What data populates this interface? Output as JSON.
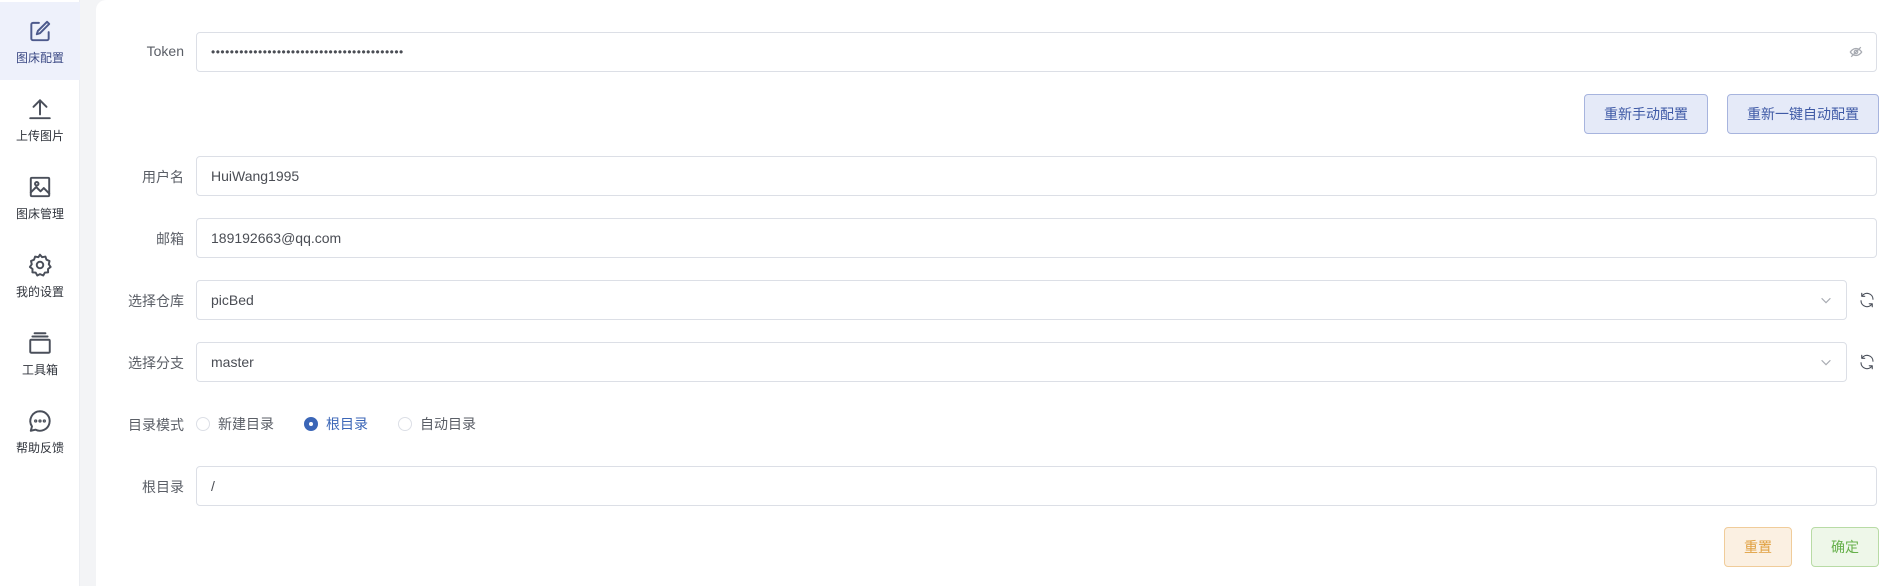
{
  "sidebar": {
    "items": [
      {
        "label": "图床配置",
        "icon": "edit-icon",
        "active": true
      },
      {
        "label": "上传图片",
        "icon": "upload-icon",
        "active": false
      },
      {
        "label": "图床管理",
        "icon": "image-icon",
        "active": false
      },
      {
        "label": "我的设置",
        "icon": "gear-icon",
        "active": false
      },
      {
        "label": "工具箱",
        "icon": "toolbox-icon",
        "active": false
      },
      {
        "label": "帮助反馈",
        "icon": "chat-icon",
        "active": false
      }
    ]
  },
  "form": {
    "token": {
      "label": "Token",
      "value": "•••••••••••••••••••••••••••••••••••••••••"
    },
    "reconfig_manual_label": "重新手动配置",
    "reconfig_auto_label": "重新一键自动配置",
    "username": {
      "label": "用户名",
      "value": "HuiWang1995"
    },
    "email": {
      "label": "邮箱",
      "value": "189192663@qq.com"
    },
    "repo": {
      "label": "选择仓库",
      "value": "picBed"
    },
    "branch": {
      "label": "选择分支",
      "value": "master"
    },
    "dir_mode": {
      "label": "目录模式",
      "options": [
        "新建目录",
        "根目录",
        "自动目录"
      ],
      "selected": "根目录"
    },
    "root_dir": {
      "label": "根目录",
      "value": "/"
    },
    "reset_label": "重置",
    "confirm_label": "确定"
  },
  "colors": {
    "accent": "#3b66b7",
    "active_nav_bg": "#eef1fb",
    "reset": "#e0a040",
    "confirm": "#66b04a"
  }
}
